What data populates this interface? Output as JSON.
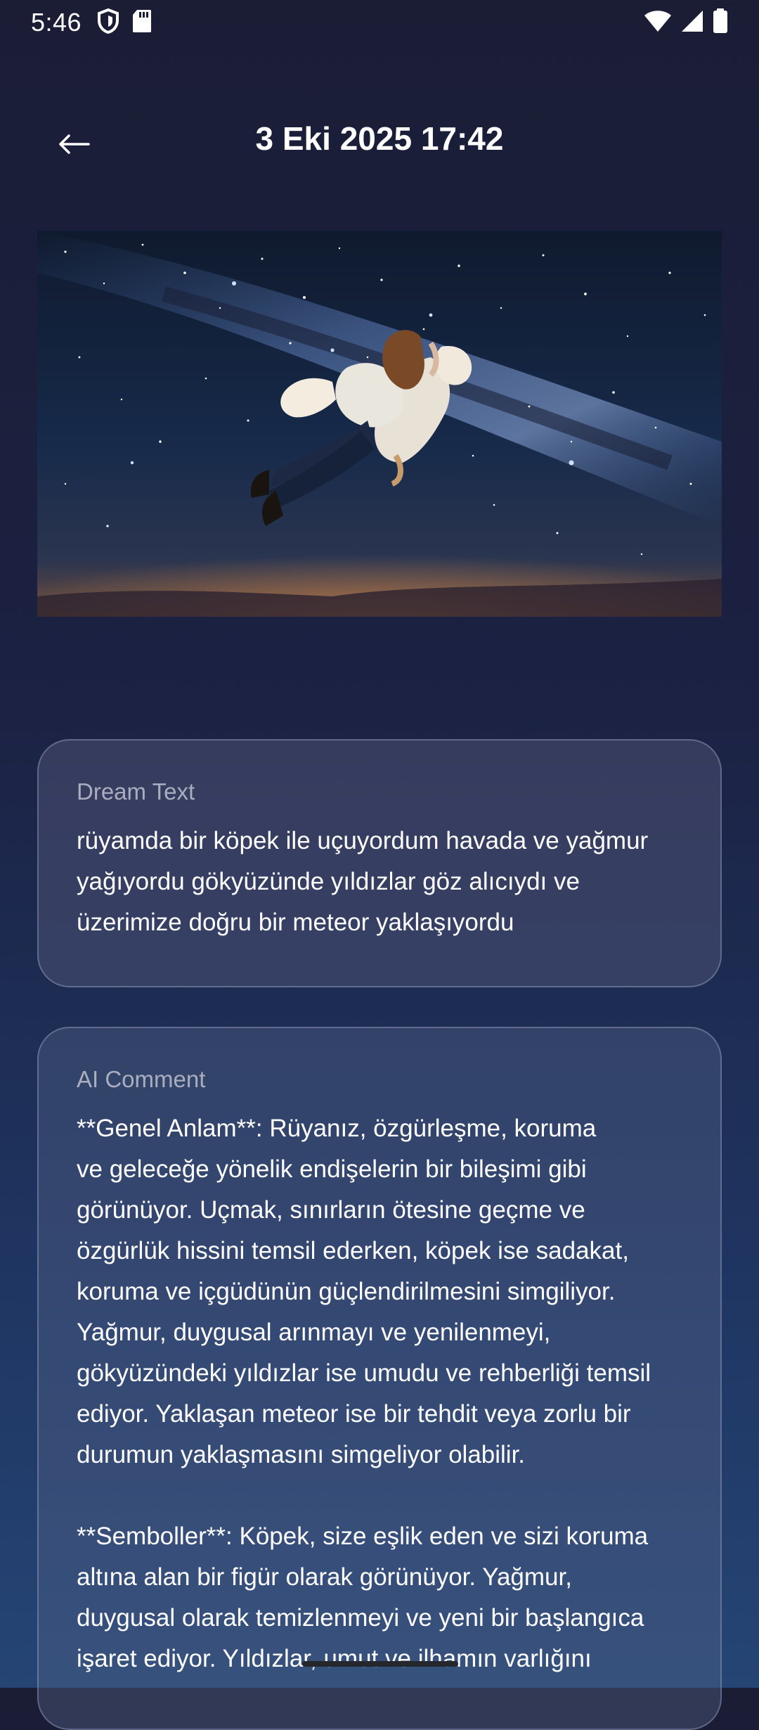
{
  "status_bar": {
    "time": "5:46",
    "icons": [
      "shield-icon",
      "sd-card-icon",
      "wifi-icon",
      "signal-icon",
      "battery-icon"
    ]
  },
  "header": {
    "back_icon": "arrow-left-icon",
    "title": "3 Eki 2025 17:42"
  },
  "dream_image": {
    "description_icon": "dream-illustration-image"
  },
  "dream_card": {
    "label": "Dream Text",
    "text": "rüyamda bir köpek ile uçuyordum havada ve yağmur\nyağıyordu gökyüzünde yıldızlar göz alıcıydı ve\nüzerimize doğru bir meteor yaklaşıyordu"
  },
  "ai_card": {
    "label": "AI Comment",
    "text": "**Genel Anlam**: Rüyanız, özgürleşme, koruma\nve geleceğe yönelik endişelerin bir bileşimi gibi\ngörünüyor. Uçmak, sınırların ötesine geçme ve\nözgürlük hissini temsil ederken, köpek ise sadakat,\nkoruma ve içgüdünün güçlendirilmesini simgiliyor.\nYağmur, duygusal arınmayı ve yenilenmeyi,\ngökyüzündeki yıldızlar ise umudu ve rehberliği temsil\nediyor. Yaklaşan meteor ise bir tehdit veya zorlu bir\ndurumun yaklaşmasını simgeliyor olabilir.\n\n**Semboller**: Köpek, size eşlik eden ve sizi koruma\naltına alan bir figür olarak görünüyor. Yağmur,\nduygusal olarak temizlenmeyi ve yeni bir başlangıca\nişaret ediyor. Yıldızlar, umut ve ilhamın varlığını"
  },
  "colors": {
    "background_top": "#1b1d35",
    "background_bottom": "#254575",
    "label": "#a9adbd",
    "text": "#ffffff"
  }
}
